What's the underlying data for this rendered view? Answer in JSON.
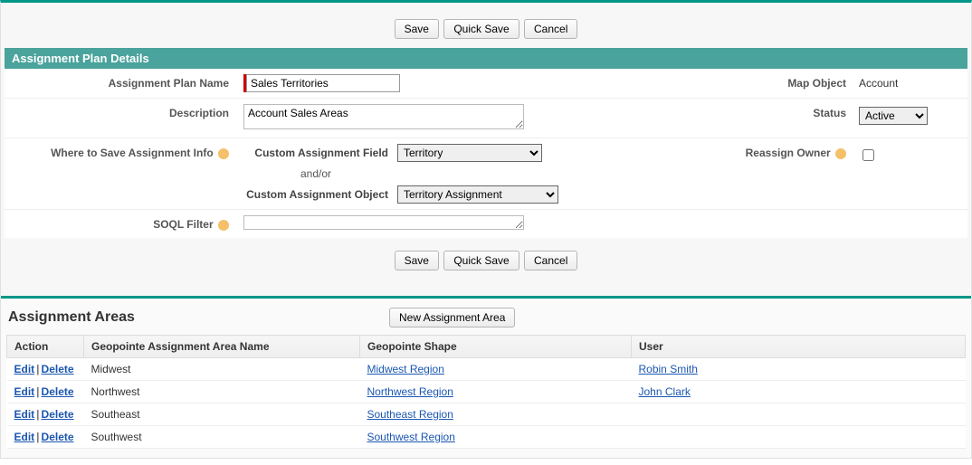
{
  "buttons": {
    "save": "Save",
    "quick_save": "Quick Save",
    "cancel": "Cancel",
    "new_area": "New Assignment Area"
  },
  "section": {
    "details_header": "Assignment Plan Details",
    "areas_header": "Assignment Areas"
  },
  "labels": {
    "plan_name": "Assignment Plan Name",
    "description": "Description",
    "where_save": "Where to Save Assignment Info",
    "custom_field": "Custom Assignment Field",
    "andor": "and/or",
    "custom_object": "Custom Assignment Object",
    "soql": "SOQL Filter",
    "map_object": "Map Object",
    "status": "Status",
    "reassign": "Reassign Owner"
  },
  "values": {
    "plan_name": "Sales Territories",
    "description": "Account Sales Areas",
    "custom_field": "Territory",
    "custom_object": "Territory Assignment",
    "soql": "",
    "map_object": "Account",
    "status": "Active",
    "reassign_checked": false
  },
  "options": {
    "custom_field": [
      "Territory"
    ],
    "custom_object": [
      "Territory Assignment"
    ],
    "status": [
      "Active"
    ]
  },
  "table": {
    "headers": {
      "action": "Action",
      "area_name": "Geopointe Assignment Area Name",
      "shape": "Geopointe Shape",
      "user": "User"
    },
    "action_edit": "Edit",
    "action_delete": "Delete",
    "rows": [
      {
        "name": "Midwest",
        "shape": "Midwest Region",
        "user": "Robin Smith"
      },
      {
        "name": "Northwest",
        "shape": "Northwest Region",
        "user": "John Clark"
      },
      {
        "name": "Southeast",
        "shape": "Southeast Region",
        "user": ""
      },
      {
        "name": "Southwest",
        "shape": "Southwest Region",
        "user": ""
      }
    ]
  }
}
